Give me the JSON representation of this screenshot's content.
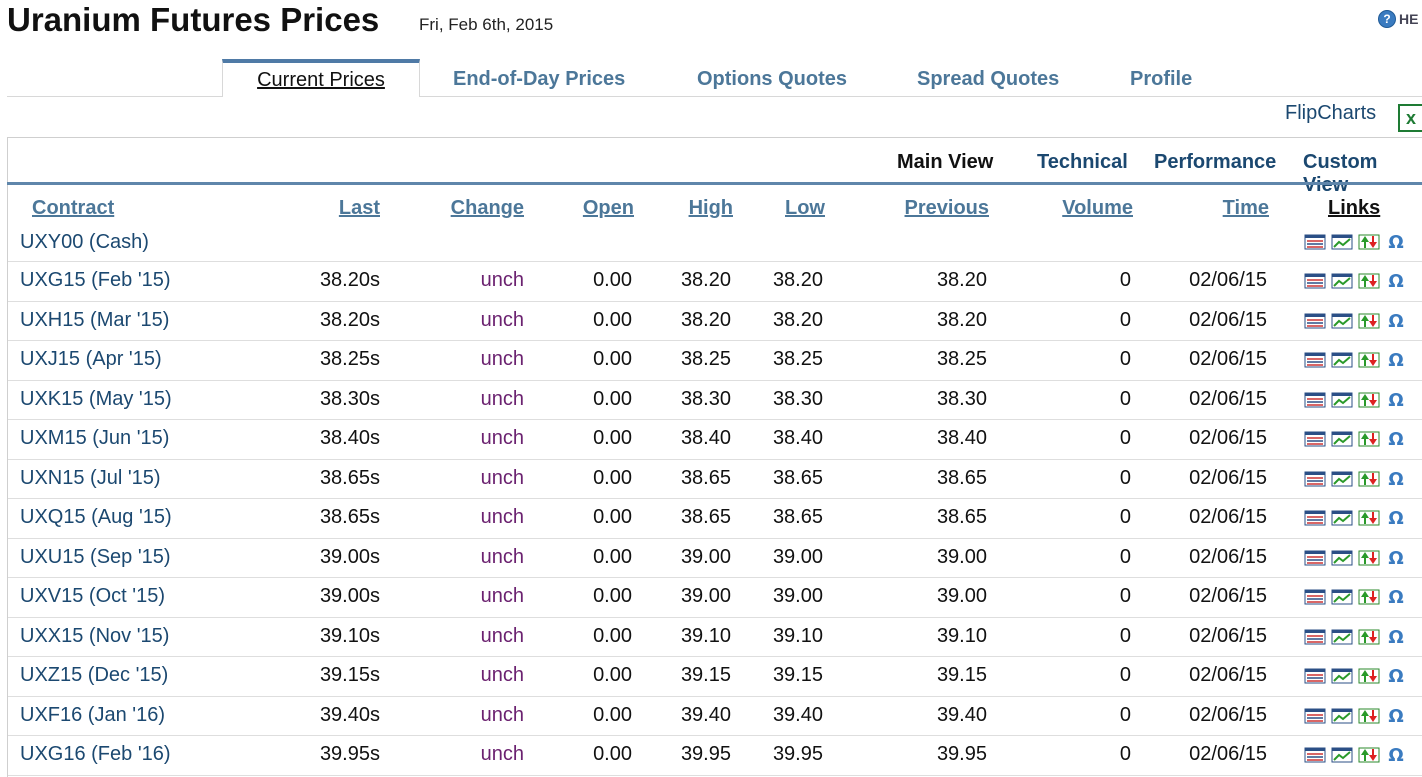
{
  "header": {
    "title": "Uranium Futures Prices",
    "date": "Fri, Feb 6th, 2015",
    "help_label": "HE"
  },
  "tabs": [
    {
      "label": "Current Prices",
      "active": true
    },
    {
      "label": "End-of-Day Prices"
    },
    {
      "label": "Options Quotes"
    },
    {
      "label": "Spread Quotes"
    },
    {
      "label": "Profile"
    }
  ],
  "toolbar": {
    "flipcharts": "FlipCharts",
    "excel_icon": "excel-icon"
  },
  "views": [
    {
      "label": "Main View",
      "active": true
    },
    {
      "label": "Technical"
    },
    {
      "label": "Performance"
    },
    {
      "label": "Custom View"
    }
  ],
  "columns": {
    "contract": "Contract",
    "last": "Last",
    "change": "Change",
    "open": "Open",
    "high": "High",
    "low": "Low",
    "previous": "Previous",
    "volume": "Volume",
    "time": "Time",
    "links": "Links"
  },
  "rows": [
    {
      "contract": "UXY00 (Cash)",
      "last": "",
      "change": "",
      "open": "",
      "high": "",
      "low": "",
      "previous": "",
      "volume": "",
      "time": ""
    },
    {
      "contract": "UXG15 (Feb '15)",
      "last": "38.20s",
      "change": "unch",
      "open": "0.00",
      "high": "38.20",
      "low": "38.20",
      "previous": "38.20",
      "volume": "0",
      "time": "02/06/15"
    },
    {
      "contract": "UXH15 (Mar '15)",
      "last": "38.20s",
      "change": "unch",
      "open": "0.00",
      "high": "38.20",
      "low": "38.20",
      "previous": "38.20",
      "volume": "0",
      "time": "02/06/15"
    },
    {
      "contract": "UXJ15 (Apr '15)",
      "last": "38.25s",
      "change": "unch",
      "open": "0.00",
      "high": "38.25",
      "low": "38.25",
      "previous": "38.25",
      "volume": "0",
      "time": "02/06/15"
    },
    {
      "contract": "UXK15 (May '15)",
      "last": "38.30s",
      "change": "unch",
      "open": "0.00",
      "high": "38.30",
      "low": "38.30",
      "previous": "38.30",
      "volume": "0",
      "time": "02/06/15"
    },
    {
      "contract": "UXM15 (Jun '15)",
      "last": "38.40s",
      "change": "unch",
      "open": "0.00",
      "high": "38.40",
      "low": "38.40",
      "previous": "38.40",
      "volume": "0",
      "time": "02/06/15"
    },
    {
      "contract": "UXN15 (Jul '15)",
      "last": "38.65s",
      "change": "unch",
      "open": "0.00",
      "high": "38.65",
      "low": "38.65",
      "previous": "38.65",
      "volume": "0",
      "time": "02/06/15"
    },
    {
      "contract": "UXQ15 (Aug '15)",
      "last": "38.65s",
      "change": "unch",
      "open": "0.00",
      "high": "38.65",
      "low": "38.65",
      "previous": "38.65",
      "volume": "0",
      "time": "02/06/15"
    },
    {
      "contract": "UXU15 (Sep '15)",
      "last": "39.00s",
      "change": "unch",
      "open": "0.00",
      "high": "39.00",
      "low": "39.00",
      "previous": "39.00",
      "volume": "0",
      "time": "02/06/15"
    },
    {
      "contract": "UXV15 (Oct '15)",
      "last": "39.00s",
      "change": "unch",
      "open": "0.00",
      "high": "39.00",
      "low": "39.00",
      "previous": "39.00",
      "volume": "0",
      "time": "02/06/15"
    },
    {
      "contract": "UXX15 (Nov '15)",
      "last": "39.10s",
      "change": "unch",
      "open": "0.00",
      "high": "39.10",
      "low": "39.10",
      "previous": "39.10",
      "volume": "0",
      "time": "02/06/15"
    },
    {
      "contract": "UXZ15 (Dec '15)",
      "last": "39.15s",
      "change": "unch",
      "open": "0.00",
      "high": "39.15",
      "low": "39.15",
      "previous": "39.15",
      "volume": "0",
      "time": "02/06/15"
    },
    {
      "contract": "UXF16 (Jan '16)",
      "last": "39.40s",
      "change": "unch",
      "open": "0.00",
      "high": "39.40",
      "low": "39.40",
      "previous": "39.40",
      "volume": "0",
      "time": "02/06/15"
    },
    {
      "contract": "UXG16 (Feb '16)",
      "last": "39.95s",
      "change": "unch",
      "open": "0.00",
      "high": "39.95",
      "low": "39.95",
      "previous": "39.95",
      "volume": "0",
      "time": "02/06/15"
    }
  ],
  "link_icons": [
    "quote-table-icon",
    "chart-icon",
    "up-down-arrows-icon",
    "options-omega-icon"
  ],
  "colors": {
    "link_blue": "#1b4870",
    "header_blue": "#4c7799",
    "change_purple": "#6b2270",
    "accent_bar": "#5f86ab"
  }
}
